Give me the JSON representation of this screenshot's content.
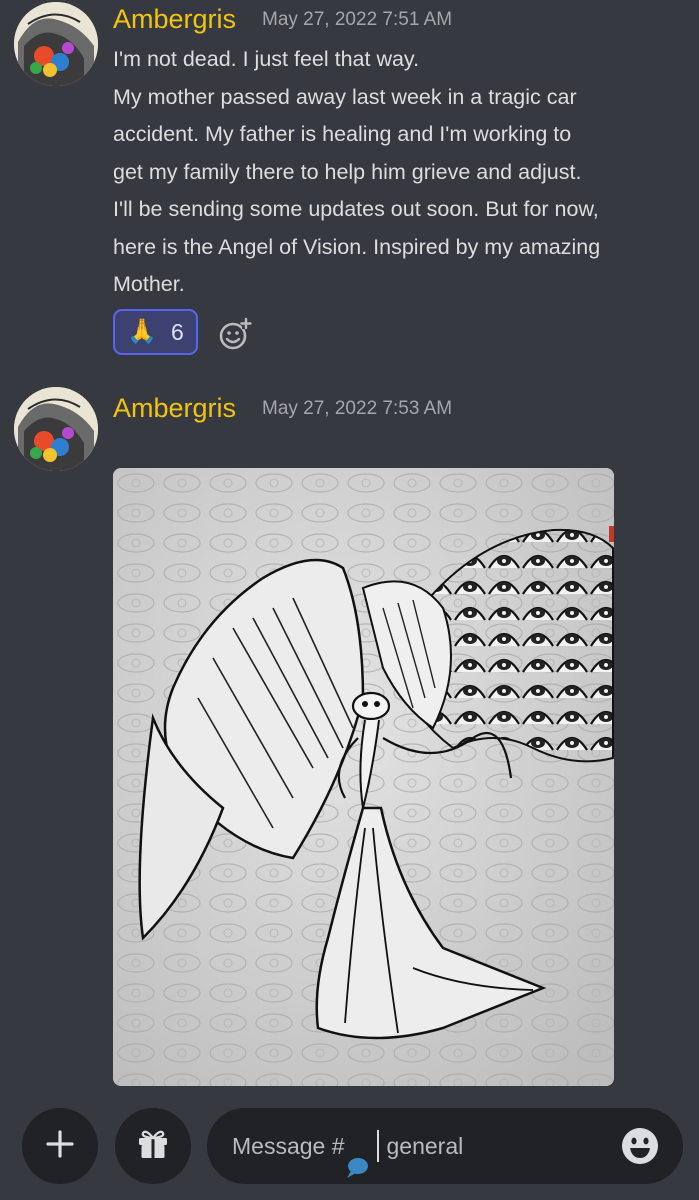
{
  "messages": [
    {
      "author": "Ambergris",
      "timestamp": "May 27, 2022 7:51 AM",
      "lines": [
        "I'm not dead. I just feel that way.",
        "My mother passed away last week in a tragic car",
        "accident. My father is healing and I'm working to",
        "get my family there to help him grieve and adjust.",
        "I'll be sending some updates out soon. But for now,",
        "here is the Angel of Vision. Inspired by my amazing",
        "Mother."
      ],
      "reaction": {
        "emoji": "🙏",
        "count": "6"
      }
    },
    {
      "author": "Ambergris",
      "timestamp": "May 27, 2022 7:53 AM"
    }
  ],
  "composer": {
    "placeholder_prefix": "Message #",
    "channel_name": "general"
  },
  "icons": {
    "add": "plus-icon",
    "gift": "gift-icon",
    "emoji": "smiley-icon",
    "add_reaction": "add-reaction-icon",
    "channel_emoji": "speech-bubble-icon"
  },
  "colors": {
    "background": "#36393f",
    "username": "#f1c40f",
    "reaction_border": "#5865f2",
    "input_bg": "#202225"
  }
}
